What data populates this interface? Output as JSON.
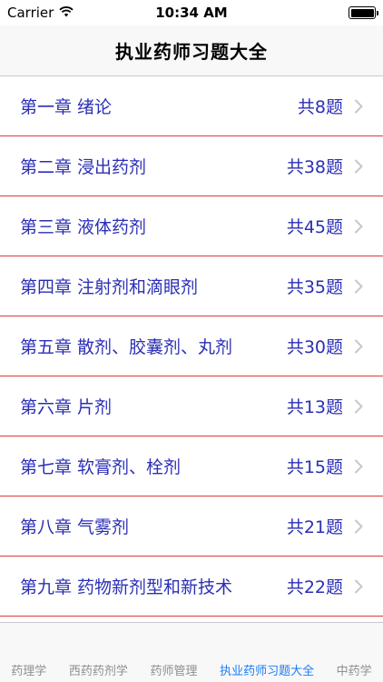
{
  "status_bar": {
    "carrier": "Carrier",
    "time": "10:34 AM",
    "battery_level": 1.0
  },
  "nav": {
    "title": "执业药师习题大全"
  },
  "chapters": [
    {
      "title": "第一章  绪论",
      "count": "共8题"
    },
    {
      "title": "第二章 浸出药剂",
      "count": "共38题"
    },
    {
      "title": "第三章 液体药剂",
      "count": "共45题"
    },
    {
      "title": "第四章 注射剂和滴眼剂",
      "count": "共35题"
    },
    {
      "title": "第五章 散剂、胶囊剂、丸剂",
      "count": "共30题"
    },
    {
      "title": "第六章 片剂",
      "count": "共13题"
    },
    {
      "title": "第七章 软膏剂、栓剂",
      "count": "共15题"
    },
    {
      "title": "第八章 气雾剂",
      "count": "共21题"
    },
    {
      "title": "第九章 药物新剂型和新技术",
      "count": "共22题"
    }
  ],
  "tabs": [
    {
      "label": "药理学",
      "active": false
    },
    {
      "label": "西药药剂学",
      "active": false
    },
    {
      "label": "药师管理",
      "active": false
    },
    {
      "label": "执业药师习题大全",
      "active": true
    },
    {
      "label": "中药学",
      "active": false
    }
  ],
  "colors": {
    "accent": "#1a7cf5",
    "text_blue": "#2b2fb5",
    "separator": "#e0383b"
  }
}
